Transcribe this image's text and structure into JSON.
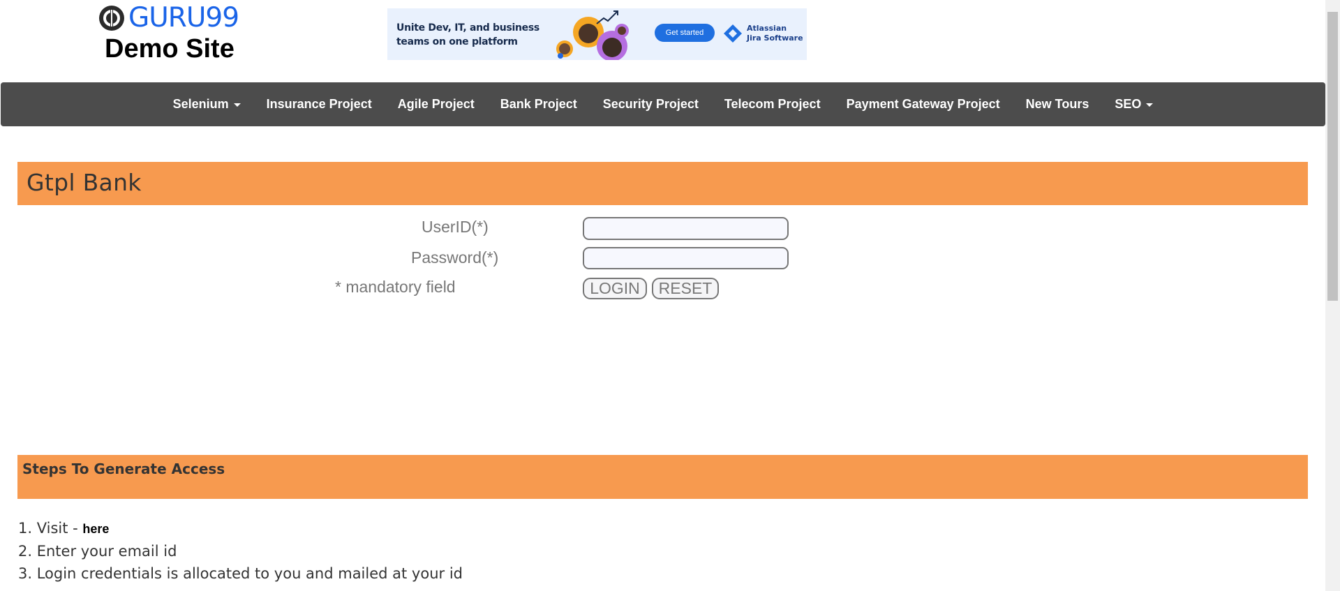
{
  "logo": {
    "brand": "GURU99",
    "subtitle": "Demo Site"
  },
  "ad": {
    "headline": "Unite Dev, IT, and business teams on one platform",
    "cta": "Get started",
    "brand_line1": "Atlassian",
    "brand_line2": "Jira Software"
  },
  "nav": {
    "items": [
      {
        "label": "Selenium",
        "dropdown": true
      },
      {
        "label": "Insurance Project"
      },
      {
        "label": "Agile Project"
      },
      {
        "label": "Bank Project"
      },
      {
        "label": "Security Project"
      },
      {
        "label": "Telecom Project"
      },
      {
        "label": "Payment Gateway Project"
      },
      {
        "label": "New Tours"
      },
      {
        "label": "SEO",
        "dropdown": true
      }
    ]
  },
  "bank": {
    "title": "Gtpl Bank"
  },
  "form": {
    "userid_label": "UserID(*)",
    "password_label": "Password(*)",
    "mandatory_note": "* mandatory field",
    "userid_value": "",
    "password_value": "",
    "login_label": "LOGIN",
    "reset_label": "RESET"
  },
  "steps": {
    "title": "Steps To Generate Access",
    "step1_prefix": "1. Visit - ",
    "step1_link": "here",
    "step2": "2. Enter your email id",
    "step3": "3. Login credentials is allocated to you and mailed at your id"
  },
  "colors": {
    "accent_orange": "#f79a4f",
    "nav_bg": "#4c4c4c",
    "logo_blue": "#1a64e8"
  }
}
